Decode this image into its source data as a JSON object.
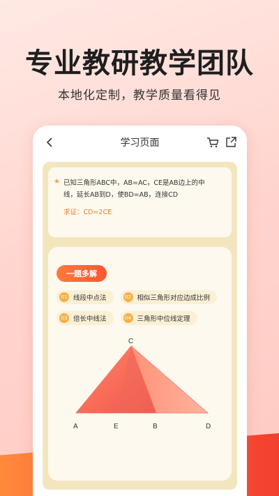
{
  "headline": "专业教研教学团队",
  "subheadline": "本地化定制，教学质量看得见",
  "topbar": {
    "title": "学习页面"
  },
  "question": {
    "line1": "已知三角形ABC中，AB=AC，CE是AB边上的中",
    "line2": "线，延长AB到D，使BD=AB，连接CD",
    "prove": "求证：CD=2CE"
  },
  "solutions": {
    "badge": "一题多解",
    "methods": [
      {
        "num": "01",
        "label": "线段中点法"
      },
      {
        "num": "02",
        "label": "相似三角形对应边成比例"
      },
      {
        "num": "03",
        "label": "倍长中线法"
      },
      {
        "num": "04",
        "label": "三角形中位线定理"
      }
    ]
  },
  "diagram": {
    "labels": {
      "A": "A",
      "E": "E",
      "B": "B",
      "C": "C",
      "D": "D"
    }
  },
  "colors": {
    "accent": "#ff5a3c",
    "orange": "#f07a2e",
    "badge_gold": "#f4b148",
    "panel": "#f3e6bf"
  }
}
